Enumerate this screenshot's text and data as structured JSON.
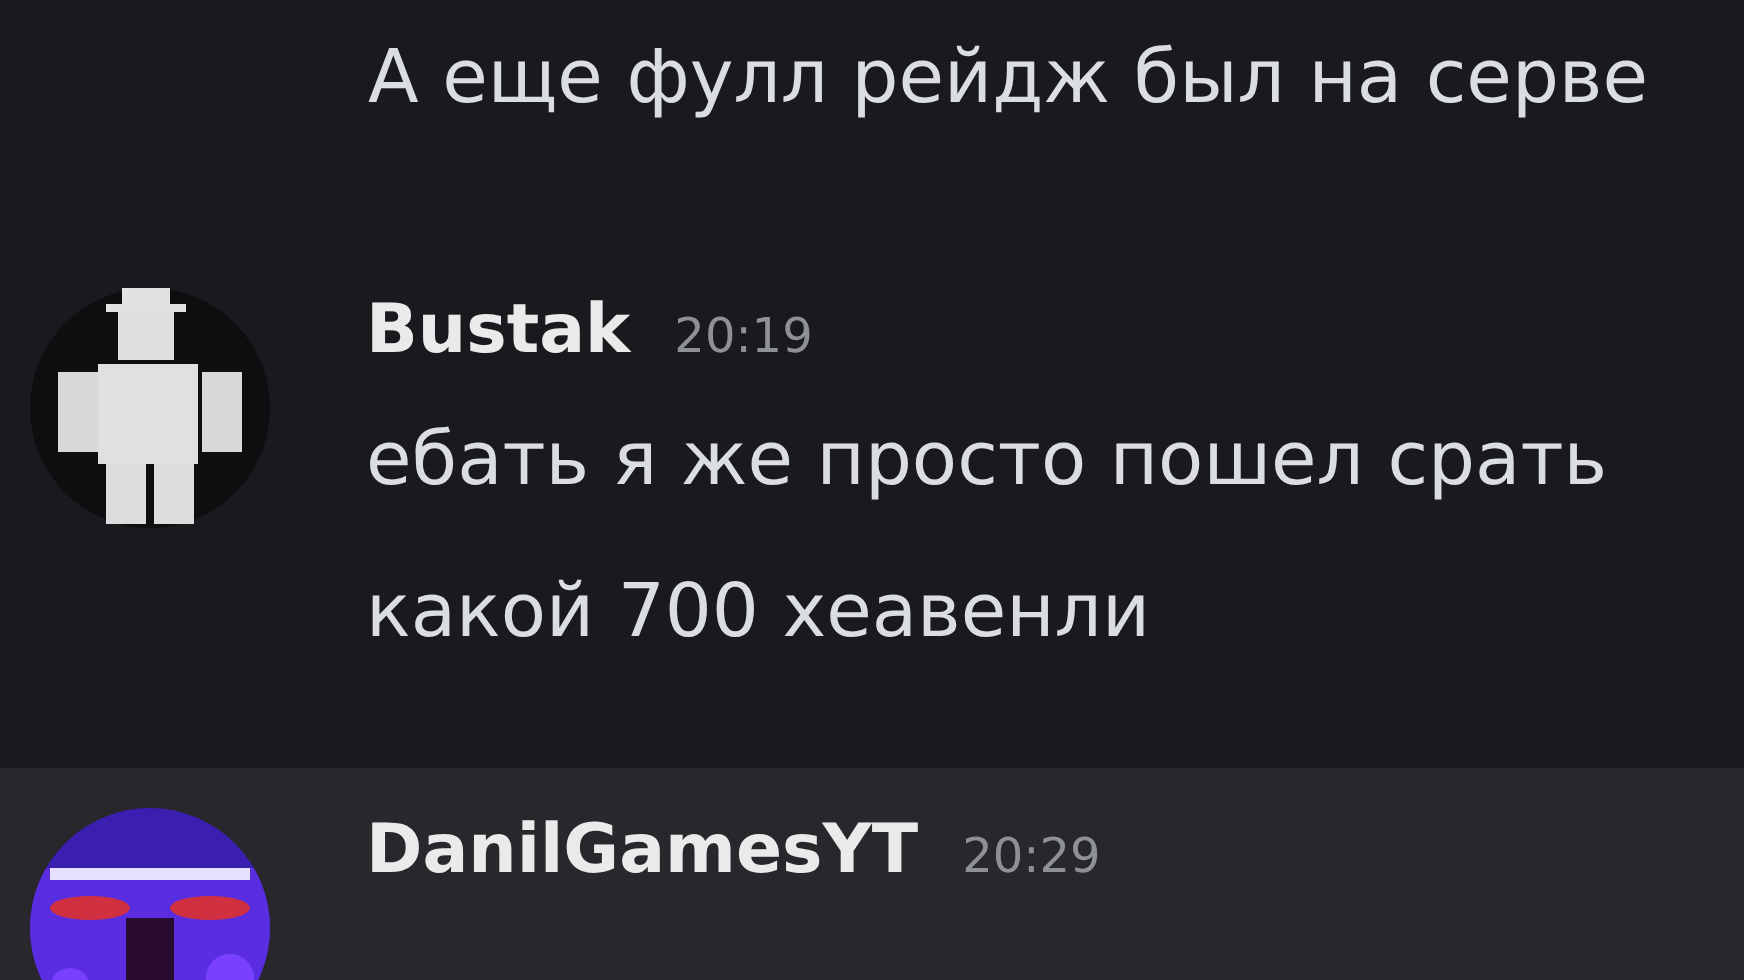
{
  "messages": [
    {
      "kind": "continuation",
      "highlighted": false,
      "lines": [
        "А еще фулл рейдж был на серве"
      ]
    },
    {
      "kind": "group",
      "highlighted": false,
      "avatar": {
        "kind": "figure"
      },
      "author": "Bustak",
      "time": "20:19",
      "lines": [
        "ебать я же просто пошел срать",
        "какой 700 хеавенли"
      ]
    },
    {
      "kind": "group",
      "highlighted": true,
      "author": "DanilGamesYT",
      "time": "20:29"
    }
  ]
}
